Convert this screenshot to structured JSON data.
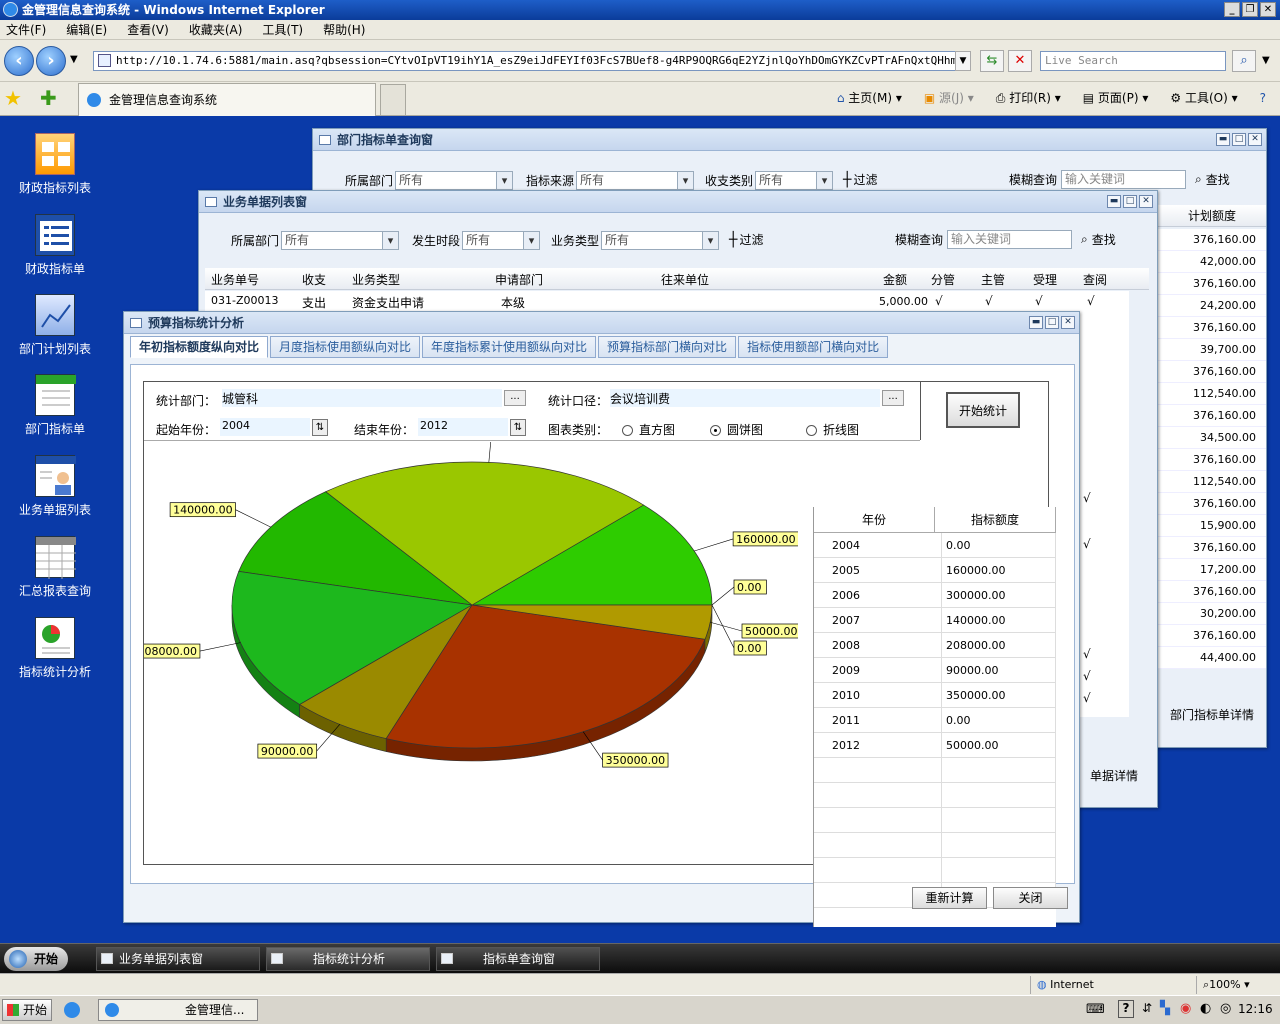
{
  "browser": {
    "title": "金管理信息查询系统 - Windows Internet Explorer",
    "menu": [
      "文件(F)",
      "编辑(E)",
      "查看(V)",
      "收藏夹(A)",
      "工具(T)",
      "帮助(H)"
    ],
    "url": "http://10.1.74.6:5881/main.asq?qbsession=CYtvOIpVT19ihY1A_esZ9eiJdFEYIf03FcS7BUef8-g4RP9OQRG6qE2YZjnlQoYhDOmGYKZCvPTrAFnQxtQHhm6h9CUoeCci",
    "search_placeholder": "Live Search",
    "tab_title": "金管理信息查询系统",
    "cmd": {
      "home": "主页(M)",
      "feeds": "源(J)",
      "print": "打印(R)",
      "page": "页面(P)",
      "tools": "工具(O)"
    },
    "status_zone": "Internet",
    "zoom": "100%"
  },
  "desktop_icons": [
    {
      "label": "财政指标列表",
      "icon": "grid-icon"
    },
    {
      "label": "财政指标单",
      "icon": "list-icon"
    },
    {
      "label": "部门计划列表",
      "icon": "chart-doc-icon"
    },
    {
      "label": "部门指标单",
      "icon": "calendar-icon"
    },
    {
      "label": "业务单据列表",
      "icon": "user-card-icon"
    },
    {
      "label": "汇总报表查询",
      "icon": "table-icon"
    },
    {
      "label": "指标统计分析",
      "icon": "pie-doc-icon"
    }
  ],
  "win_dept": {
    "title": "部门指标单查询窗",
    "f_dept": "所属部门",
    "f_dept_val": "所有",
    "f_src": "指标来源",
    "f_src_val": "所有",
    "f_type": "收支类别",
    "f_type_val": "所有",
    "filter": "过滤",
    "fuzzy": "模糊查询",
    "fuzzy_ph": "输入关键词",
    "find": "查找",
    "col_plan": "计划额度",
    "plan_values": [
      "376,160.00",
      "42,000.00",
      "376,160.00",
      "24,200.00",
      "376,160.00",
      "39,700.00",
      "376,160.00",
      "112,540.00",
      "376,160.00",
      "34,500.00",
      "376,160.00",
      "112,540.00",
      "376,160.00",
      "15,900.00",
      "376,160.00",
      "17,200.00",
      "376,160.00",
      "30,200.00",
      "376,160.00",
      "44,400.00"
    ],
    "detail_btn": "部门指标单详情"
  },
  "win_biz": {
    "title": "业务单据列表窗",
    "f_dept": "所属部门",
    "f_dept_val": "所有",
    "f_time": "发生时段",
    "f_time_val": "所有",
    "f_type": "业务类型",
    "f_type_val": "所有",
    "filter": "过滤",
    "fuzzy": "模糊查询",
    "fuzzy_ph": "输入关键词",
    "find": "查找",
    "columns": [
      "业务单号",
      "收支",
      "业务类型",
      "申请部门",
      "往来单位",
      "金额",
      "分管",
      "主管",
      "受理",
      "查阅"
    ],
    "row1": {
      "no": "031-Z00013",
      "io": "支出",
      "type": "资金支出申请",
      "dept": "本级",
      "unit": "",
      "amount": "5,000.00",
      "c1": "√",
      "c2": "√",
      "c3": "√",
      "c4": "√"
    },
    "check": "√",
    "detail_btn": "单据详情"
  },
  "win_stats": {
    "title": "预算指标统计分析",
    "tabs": [
      "年初指标额度纵向对比",
      "月度指标使用额纵向对比",
      "年度指标累计使用额纵向对比",
      "预算指标部门横向对比",
      "指标使用额部门横向对比"
    ],
    "dept_label": "统计部门：",
    "dept_val": "城管科",
    "scope_label": "统计口径：",
    "scope_val": "会议培训费",
    "start_label": "起始年份：",
    "start_val": "2004",
    "end_label": "结束年份：",
    "end_val": "2012",
    "chart_type_label": "图表类别：",
    "opt_bar": "直方图",
    "opt_pie": "圆饼图",
    "opt_line": "折线图",
    "selected": "pie",
    "start_btn": "开始统计",
    "dots": "...",
    "grid_head": [
      "年份",
      "指标额度"
    ],
    "recalc_btn": "重新计算",
    "close_btn": "关闭"
  },
  "chart_data": {
    "type": "pie",
    "categories": [
      "2004",
      "2005",
      "2006",
      "2007",
      "2008",
      "2009",
      "2010",
      "2011",
      "2012"
    ],
    "values": [
      0,
      160000,
      300000,
      140000,
      208000,
      90000,
      350000,
      0,
      50000
    ],
    "labels": [
      "0.00",
      "160000.00",
      "300000.00",
      "140000.00",
      "208000.00",
      "90000.00",
      "350000.00",
      "0.00",
      "50000.00"
    ],
    "table_values": [
      "0.00",
      "160000.00",
      "300000.00",
      "140000.00",
      "208000.00",
      "90000.00",
      "350000.00",
      "0.00",
      "50000.00"
    ],
    "colors": [
      "#1f9a1f",
      "#2ecc00",
      "#9ac700",
      "#22b800",
      "#1db81d",
      "#9a8a00",
      "#a83200",
      "#1da81d",
      "#b09a00"
    ]
  },
  "taskbar": {
    "start": "开始",
    "items": [
      "业务单据列表窗",
      "指标统计分析",
      "指标单查询窗"
    ],
    "start2": "开始",
    "ie_item": "金管理信...",
    "time": "12:16"
  }
}
